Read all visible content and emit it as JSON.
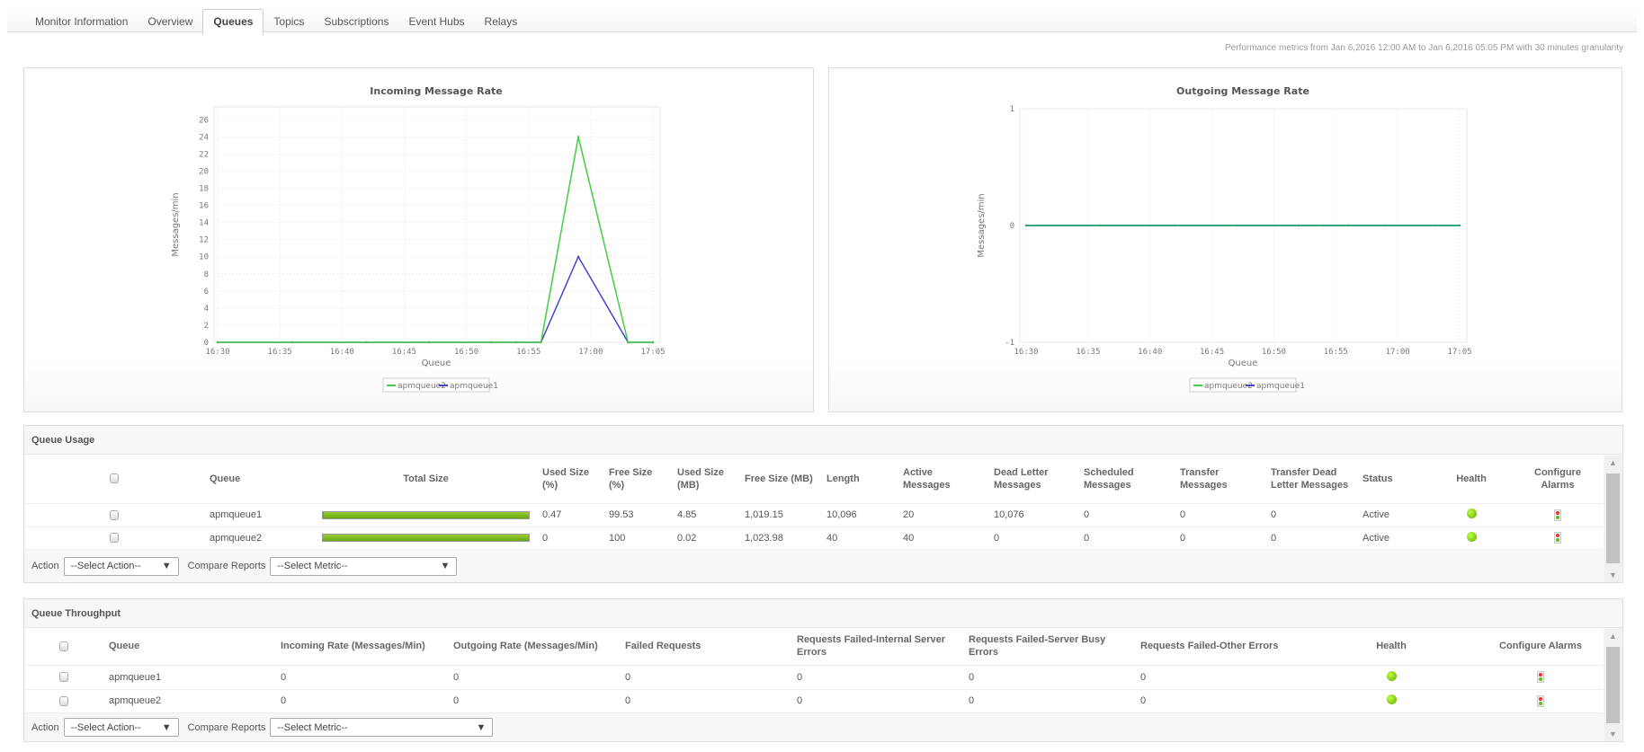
{
  "tabs": [
    "Monitor Information",
    "Overview",
    "Queues",
    "Topics",
    "Subscriptions",
    "Event Hubs",
    "Relays"
  ],
  "active_tab": "Queues",
  "perf_text": "Performance metrics from Jan 6,2016 12:00 AM to Jan 6,2016 05:05 PM with 30 minutes granularity",
  "colors": {
    "apmqueue2": "#4c4",
    "apmqueue1": "#44c",
    "outgoing_line": "#3a7"
  },
  "chart_data": [
    {
      "type": "line",
      "title": "Incoming Message Rate",
      "xlabel": "Queue",
      "ylabel": "Messages/min",
      "xticks": [
        "16:30",
        "16:35",
        "16:40",
        "16:45",
        "16:50",
        "16:55",
        "17:00",
        "17:05"
      ],
      "yticks": [
        "0",
        "2",
        "4",
        "6",
        "8",
        "10",
        "12",
        "14",
        "16",
        "18",
        "20",
        "22",
        "24",
        "26"
      ],
      "ylim": [
        0,
        27.5
      ],
      "grid": true,
      "legend": "bottom",
      "x": [
        "16:30",
        "16:36",
        "16:42",
        "16:47",
        "16:52",
        "16:54",
        "16:56",
        "16:59",
        "17:03",
        "17:05"
      ],
      "series": [
        {
          "name": "apmqueue2",
          "values": [
            0,
            0,
            0,
            0,
            0,
            0,
            0,
            24,
            0,
            0
          ]
        },
        {
          "name": "apmqueue1",
          "values": [
            0,
            0,
            0,
            0,
            0,
            0,
            0,
            10,
            0,
            0
          ]
        }
      ]
    },
    {
      "type": "line",
      "title": "Outgoing Message Rate",
      "xlabel": "Queue",
      "ylabel": "Messages/min",
      "xticks": [
        "16:30",
        "16:35",
        "16:40",
        "16:45",
        "16:50",
        "16:55",
        "17:00",
        "17:05"
      ],
      "yticks": [
        "-1",
        "0",
        "1"
      ],
      "ylim": [
        -1,
        1
      ],
      "grid": true,
      "legend": "bottom",
      "x": [
        "16:30",
        "16:36",
        "16:42",
        "16:47",
        "16:52",
        "16:54",
        "16:56",
        "16:59",
        "17:03",
        "17:05"
      ],
      "series": [
        {
          "name": "apmqueue2",
          "values": [
            0,
            0,
            0,
            0,
            0,
            0,
            0,
            0,
            0,
            0
          ]
        },
        {
          "name": "apmqueue1",
          "values": [
            0,
            0,
            0,
            0,
            0,
            0,
            0,
            0,
            0,
            0
          ]
        }
      ]
    }
  ],
  "usage": {
    "title": "Queue Usage",
    "headers": [
      "Queue",
      "Total Size",
      "Used Size (%)",
      "Free Size (%)",
      "Used Size (MB)",
      "Free Size (MB)",
      "Length",
      "Active Messages",
      "Dead Letter Messages",
      "Scheduled Messages",
      "Transfer Messages",
      "Transfer Dead Letter Messages",
      "Status",
      "Health",
      "Configure Alarms"
    ],
    "rows": [
      {
        "queue": "apmqueue1",
        "used_pct": "0.47",
        "free_pct": "99.53",
        "used_mb": "4.85",
        "free_mb": "1,019.15",
        "length": "10,096",
        "active": "20",
        "dead": "10,076",
        "scheduled": "0",
        "transfer": "0",
        "tdl": "0",
        "status": "Active"
      },
      {
        "queue": "apmqueue2",
        "used_pct": "0",
        "free_pct": "100",
        "used_mb": "0.02",
        "free_mb": "1,023.98",
        "length": "40",
        "active": "40",
        "dead": "0",
        "scheduled": "0",
        "transfer": "0",
        "tdl": "0",
        "status": "Active"
      }
    ],
    "action_label": "Action",
    "action_value": "--Select Action--",
    "compare_label": "Compare Reports",
    "compare_value": "--Select Metric--"
  },
  "throughput": {
    "title": "Queue Throughput",
    "headers": [
      "Queue",
      "Incoming Rate  (Messages/Min)",
      "Outgoing Rate  (Messages/Min)",
      "Failed Requests",
      "Requests Failed-Internal Server Errors",
      "Requests Failed-Server Busy Errors",
      "Requests Failed-Other Errors",
      "Health",
      "Configure Alarms"
    ],
    "rows": [
      {
        "queue": "apmqueue1",
        "incoming": "0",
        "outgoing": "0",
        "failed": "0",
        "internal": "0",
        "busy": "0",
        "other": "0"
      },
      {
        "queue": "apmqueue2",
        "incoming": "0",
        "outgoing": "0",
        "failed": "0",
        "internal": "0",
        "busy": "0",
        "other": "0"
      }
    ],
    "action_label": "Action",
    "action_value": "--Select Action--",
    "compare_label": "Compare Reports",
    "compare_value": "--Select Metric--"
  }
}
